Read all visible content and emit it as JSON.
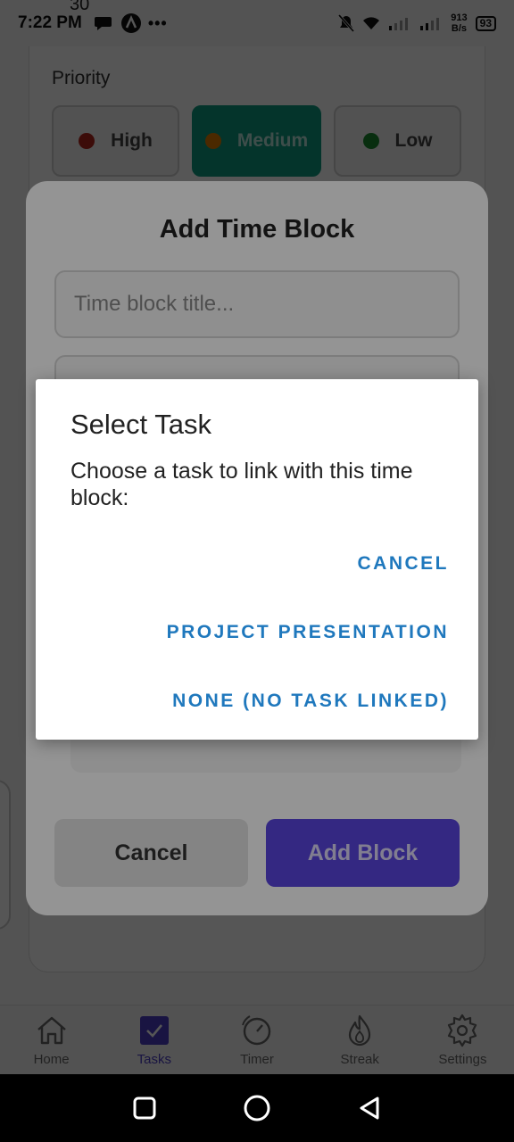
{
  "status_bar": {
    "time": "7:22 PM",
    "net_speed_value": "913",
    "net_speed_unit": "B/s",
    "battery": "93"
  },
  "background_form": {
    "cut_number": "30",
    "priority_label": "Priority",
    "priority_options": [
      {
        "label": "High",
        "color": "#b3261e"
      },
      {
        "label": "Medium",
        "color": "#e07b00"
      },
      {
        "label": "Low",
        "color": "#1b8a2e"
      }
    ],
    "selected_priority": "Medium"
  },
  "add_block_sheet": {
    "title": "Add Time Block",
    "title_placeholder": "Time block title...",
    "cancel_label": "Cancel",
    "add_label": "Add Block"
  },
  "dialog": {
    "title": "Select Task",
    "message": "Choose a task to link with this time block:",
    "buttons": [
      "CANCEL",
      "PROJECT PRESENTATION",
      "NONE (NO TASK LINKED)"
    ],
    "accent_color": "#1f78bd"
  },
  "bottom_nav": {
    "items": [
      {
        "label": "Home",
        "icon": "home-icon"
      },
      {
        "label": "Tasks",
        "icon": "check-square-icon"
      },
      {
        "label": "Timer",
        "icon": "timer-icon"
      },
      {
        "label": "Streak",
        "icon": "flame-icon"
      },
      {
        "label": "Settings",
        "icon": "gear-icon"
      }
    ],
    "active": "Tasks"
  }
}
